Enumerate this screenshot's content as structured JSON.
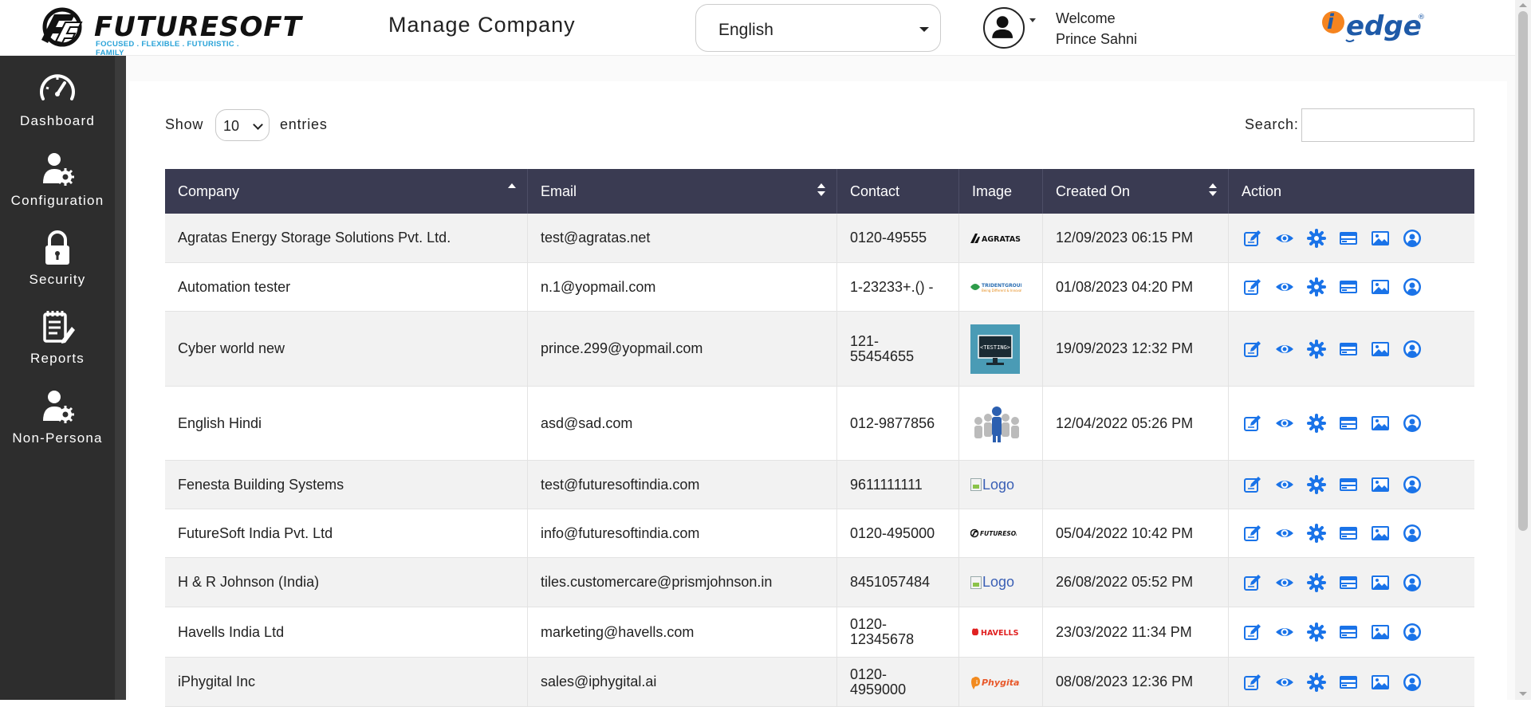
{
  "header": {
    "brand": "FUTURESOFT",
    "tagline": "FOCUSED . FLEXIBLE . FUTURISTIC . FAMILY",
    "page_title": "Manage Company",
    "language": "English",
    "welcome": "Welcome",
    "user_name": "Prince Sahni",
    "partner_logo": "i edge"
  },
  "sidebar": {
    "items": [
      {
        "label": "Dashboard",
        "icon": "speedometer-icon"
      },
      {
        "label": "Configuration",
        "icon": "user-gear-icon"
      },
      {
        "label": "Security",
        "icon": "lock-icon"
      },
      {
        "label": "Reports",
        "icon": "clipboard-icon"
      },
      {
        "label": "Non-Persona",
        "icon": "user-gear-icon"
      }
    ]
  },
  "controls": {
    "show_label": "Show",
    "entries_value": "10",
    "entries_label": "entries",
    "search_label": "Search:",
    "search_value": ""
  },
  "table": {
    "columns": [
      "Company",
      "Email",
      "Contact",
      "Image",
      "Created On",
      "Action"
    ],
    "rows": [
      {
        "company": "Agratas Energy Storage Solutions Pvt. Ltd.",
        "email": "test@agratas.net",
        "contact": "0120-49555",
        "image": "AGRATAS",
        "created": "12/09/2023 06:15 PM"
      },
      {
        "company": "Automation tester",
        "email": "n.1@yopmail.com",
        "contact": "1-23233+.() -",
        "image": "TRIDENT GROUP",
        "created": "01/08/2023 04:20 PM"
      },
      {
        "company": "Cyber world new",
        "email": "prince.299@yopmail.com",
        "contact": "121-\n55454655",
        "image": "<TESTING>",
        "created": "19/09/2023 12:32 PM"
      },
      {
        "company": "English Hindi",
        "email": "asd@sad.com",
        "contact": "012-9877856",
        "image": "people",
        "created": "12/04/2022 05:26 PM"
      },
      {
        "company": "Fenesta Building Systems",
        "email": "test@futuresoftindia.com",
        "contact": "9611111111",
        "image": "Logo",
        "created": ""
      },
      {
        "company": "FutureSoft India Pvt. Ltd",
        "email": "info@futuresoftindia.com",
        "contact": "0120-495000",
        "image": "FUTURESOFT",
        "created": "05/04/2022 10:42 PM"
      },
      {
        "company": "H & R Johnson (India)",
        "email": "tiles.customercare@prismjohnson.in",
        "contact": "8451057484",
        "image": "Logo",
        "created": "26/08/2022 05:52 PM"
      },
      {
        "company": "Havells India Ltd",
        "email": "marketing@havells.com",
        "contact": "0120-\n12345678",
        "image": "HAVELLS",
        "created": "23/03/2022 11:34 PM"
      },
      {
        "company": "iPhygital Inc",
        "email": "sales@iphygital.ai",
        "contact": "0120-\n4959000",
        "image": "Phygital",
        "created": "08/08/2023 12:36 PM"
      }
    ],
    "action_icons": [
      "edit-icon",
      "view-icon",
      "settings-icon",
      "card-icon",
      "image-icon",
      "user-icon"
    ]
  },
  "colors": {
    "header_bg": "#3a3b52",
    "sidebar_bg": "#2d2d2d",
    "action_blue": "#1a73e8",
    "row_alt": "#f2f2f2"
  }
}
